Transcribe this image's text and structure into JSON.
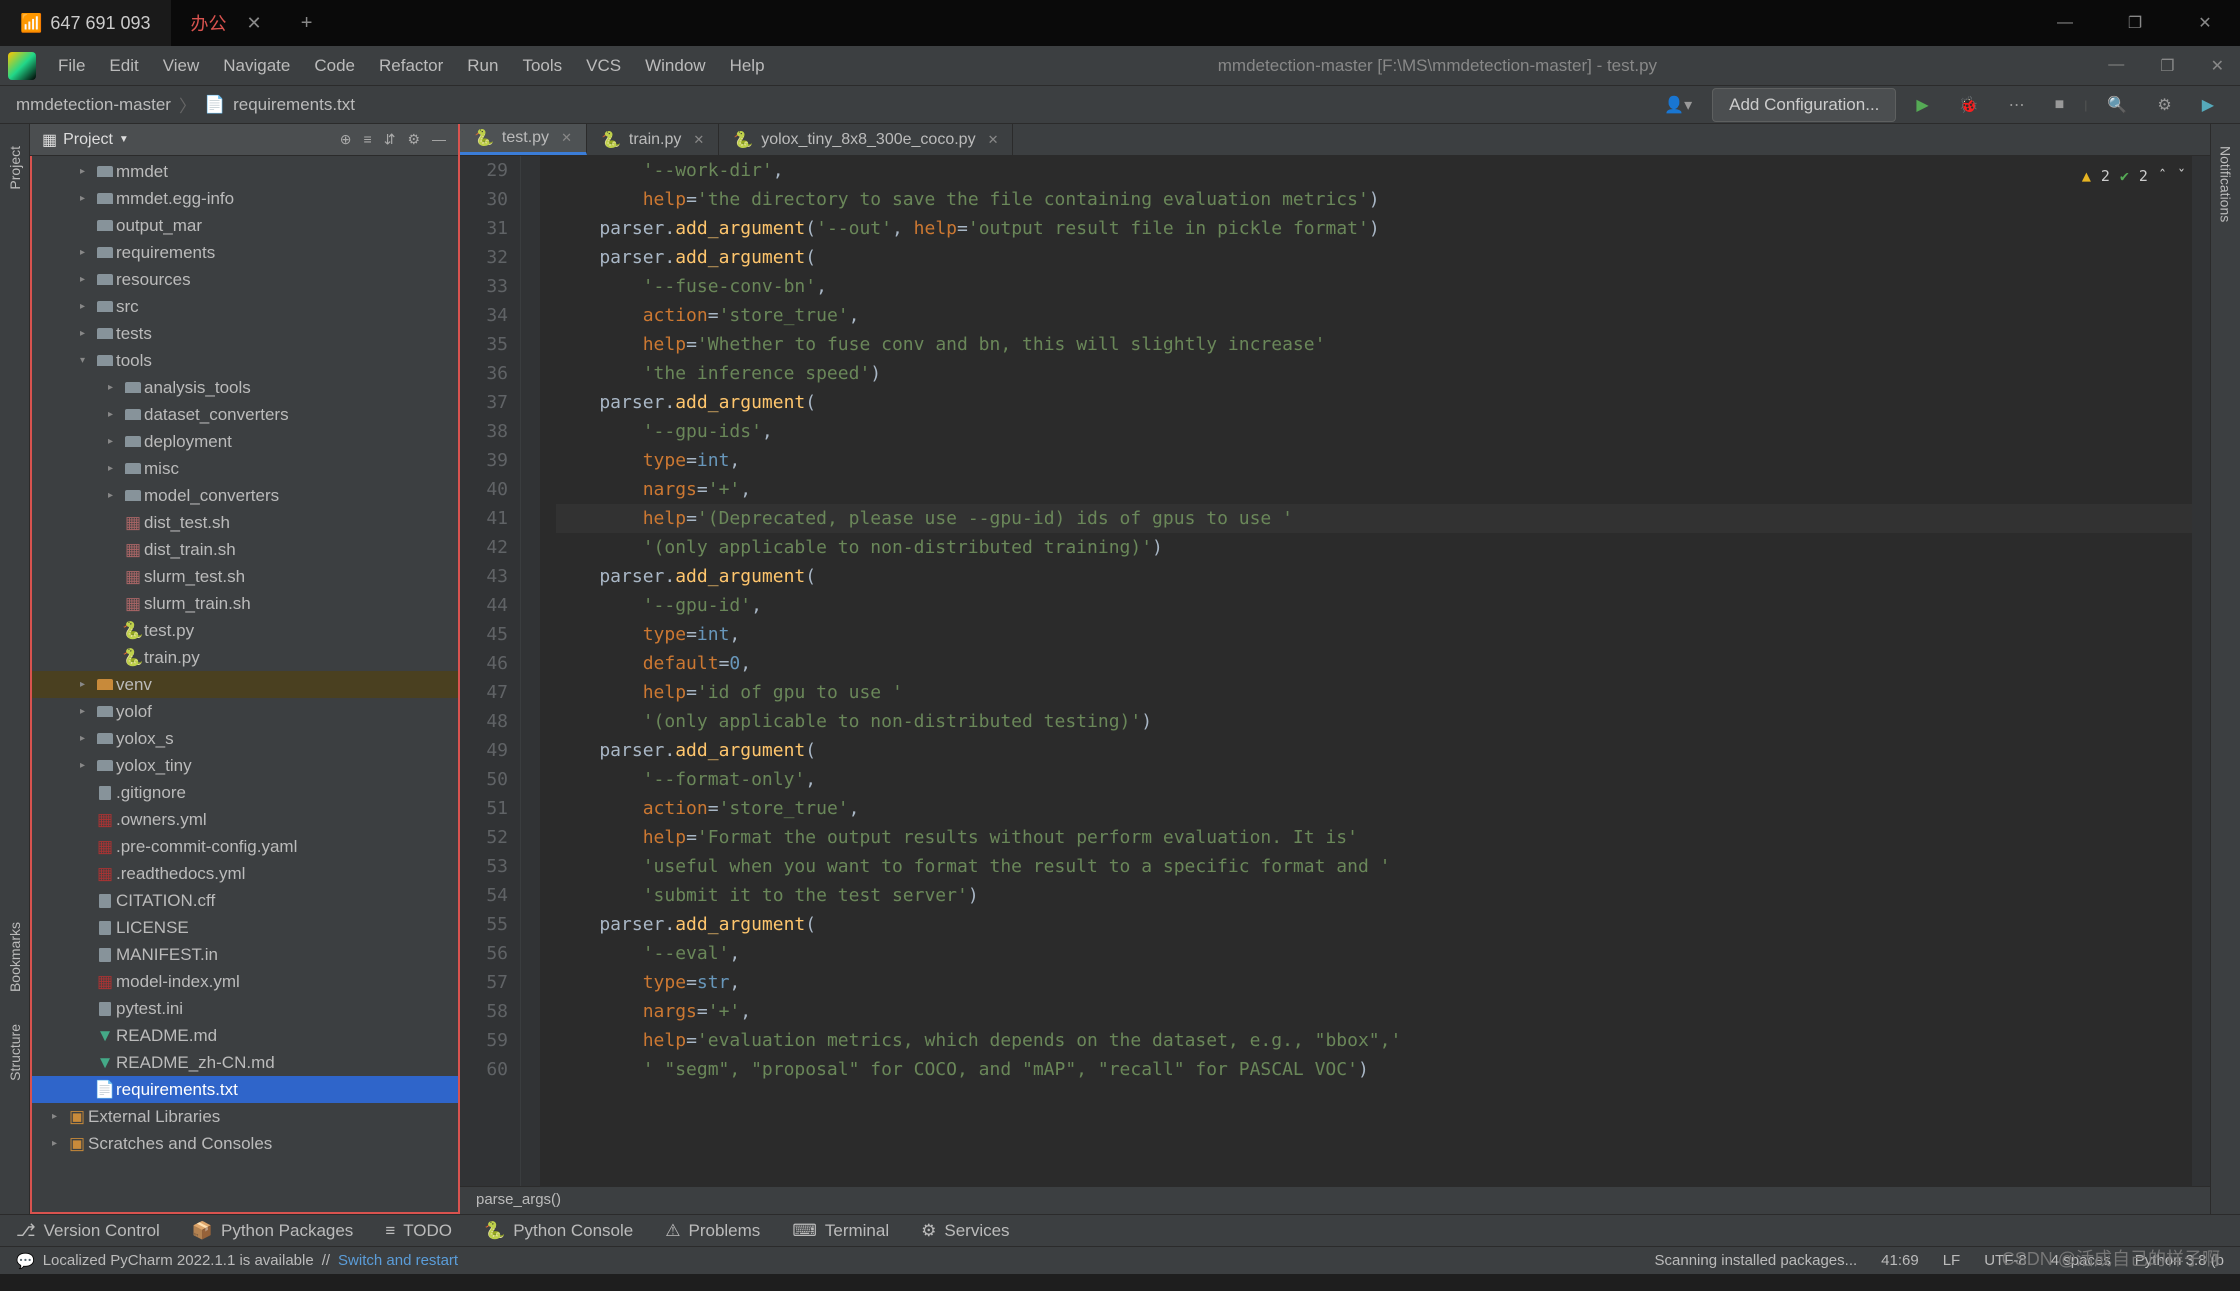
{
  "os_tab": {
    "status_icon": "📶",
    "title": "647 691 093",
    "second_label": "办公"
  },
  "ide_menu": [
    "File",
    "Edit",
    "View",
    "Navigate",
    "Code",
    "Refactor",
    "Run",
    "Tools",
    "VCS",
    "Window",
    "Help"
  ],
  "ide_title": "mmdetection-master [F:\\MS\\mmdetection-master] - test.py",
  "breadcrumb": [
    "mmdetection-master",
    "requirements.txt"
  ],
  "nav_right": {
    "add_config": "Add Configuration..."
  },
  "project_panel": {
    "title": "Project"
  },
  "tree": [
    {
      "d": 1,
      "t": "folder",
      "a": ">",
      "name": "mmdet"
    },
    {
      "d": 1,
      "t": "folder",
      "a": ">",
      "name": "mmdet.egg-info"
    },
    {
      "d": 1,
      "t": "folder",
      "a": "",
      "name": "output_mar"
    },
    {
      "d": 1,
      "t": "folder",
      "a": ">",
      "name": "requirements"
    },
    {
      "d": 1,
      "t": "folder",
      "a": ">",
      "name": "resources"
    },
    {
      "d": 1,
      "t": "folder",
      "a": ">",
      "name": "src"
    },
    {
      "d": 1,
      "t": "folder",
      "a": ">",
      "name": "tests"
    },
    {
      "d": 1,
      "t": "folder",
      "a": "v",
      "name": "tools"
    },
    {
      "d": 2,
      "t": "folder",
      "a": ">",
      "name": "analysis_tools"
    },
    {
      "d": 2,
      "t": "folder",
      "a": ">",
      "name": "dataset_converters"
    },
    {
      "d": 2,
      "t": "folder",
      "a": ">",
      "name": "deployment"
    },
    {
      "d": 2,
      "t": "folder",
      "a": ">",
      "name": "misc"
    },
    {
      "d": 2,
      "t": "folder",
      "a": ">",
      "name": "model_converters"
    },
    {
      "d": 2,
      "t": "sh",
      "a": "",
      "name": "dist_test.sh"
    },
    {
      "d": 2,
      "t": "sh",
      "a": "",
      "name": "dist_train.sh"
    },
    {
      "d": 2,
      "t": "sh",
      "a": "",
      "name": "slurm_test.sh"
    },
    {
      "d": 2,
      "t": "sh",
      "a": "",
      "name": "slurm_train.sh"
    },
    {
      "d": 2,
      "t": "py",
      "a": "",
      "name": "test.py"
    },
    {
      "d": 2,
      "t": "py",
      "a": "",
      "name": "train.py"
    },
    {
      "d": 1,
      "t": "folder-o",
      "a": ">",
      "name": "venv",
      "hl": true
    },
    {
      "d": 1,
      "t": "folder",
      "a": ">",
      "name": "yolof"
    },
    {
      "d": 1,
      "t": "folder",
      "a": ">",
      "name": "yolox_s"
    },
    {
      "d": 1,
      "t": "folder",
      "a": ">",
      "name": "yolox_tiny"
    },
    {
      "d": 1,
      "t": "file",
      "a": "",
      "name": ".gitignore"
    },
    {
      "d": 1,
      "t": "yml",
      "a": "",
      "name": ".owners.yml"
    },
    {
      "d": 1,
      "t": "yml",
      "a": "",
      "name": ".pre-commit-config.yaml"
    },
    {
      "d": 1,
      "t": "yml",
      "a": "",
      "name": ".readthedocs.yml"
    },
    {
      "d": 1,
      "t": "file",
      "a": "",
      "name": "CITATION.cff"
    },
    {
      "d": 1,
      "t": "file",
      "a": "",
      "name": "LICENSE"
    },
    {
      "d": 1,
      "t": "file",
      "a": "",
      "name": "MANIFEST.in"
    },
    {
      "d": 1,
      "t": "yml",
      "a": "",
      "name": "model-index.yml"
    },
    {
      "d": 1,
      "t": "file",
      "a": "",
      "name": "pytest.ini"
    },
    {
      "d": 1,
      "t": "md",
      "a": "",
      "name": "README.md"
    },
    {
      "d": 1,
      "t": "md",
      "a": "",
      "name": "README_zh-CN.md"
    },
    {
      "d": 1,
      "t": "txt",
      "a": "",
      "name": "requirements.txt",
      "sel": true
    }
  ],
  "tree_footer": [
    {
      "name": "External Libraries"
    },
    {
      "name": "Scratches and Consoles"
    }
  ],
  "editor_tabs": [
    {
      "name": "test.py",
      "active": true
    },
    {
      "name": "train.py"
    },
    {
      "name": "yolox_tiny_8x8_300e_coco.py"
    }
  ],
  "warnings": {
    "tri": "2",
    "check": "2"
  },
  "code_start_line": 29,
  "code_lines": [
    {
      "i": "        ",
      "t": [
        {
          "s": "'--work-dir'",
          "c": "str"
        },
        {
          "s": ","
        }
      ]
    },
    {
      "i": "        ",
      "t": [
        {
          "s": "help",
          "c": "kw"
        },
        {
          "s": "="
        },
        {
          "s": "'the directory to save the file containing evaluation metrics'",
          "c": "str"
        },
        {
          "s": ")"
        }
      ]
    },
    {
      "i": "    ",
      "t": [
        {
          "s": "parser."
        },
        {
          "s": "add_argument",
          "c": "fn"
        },
        {
          "s": "("
        },
        {
          "s": "'--out'",
          "c": "str"
        },
        {
          "s": ", "
        },
        {
          "s": "help",
          "c": "kw"
        },
        {
          "s": "="
        },
        {
          "s": "'output result file in pickle format'",
          "c": "str"
        },
        {
          "s": ")"
        }
      ]
    },
    {
      "i": "    ",
      "t": [
        {
          "s": "parser."
        },
        {
          "s": "add_argument",
          "c": "fn"
        },
        {
          "s": "("
        }
      ]
    },
    {
      "i": "        ",
      "t": [
        {
          "s": "'--fuse-conv-bn'",
          "c": "str"
        },
        {
          "s": ","
        }
      ]
    },
    {
      "i": "        ",
      "t": [
        {
          "s": "action",
          "c": "kw"
        },
        {
          "s": "="
        },
        {
          "s": "'store_true'",
          "c": "str"
        },
        {
          "s": ","
        }
      ]
    },
    {
      "i": "        ",
      "t": [
        {
          "s": "help",
          "c": "kw"
        },
        {
          "s": "="
        },
        {
          "s": "'Whether to fuse conv and bn, this will slightly increase'",
          "c": "str"
        }
      ]
    },
    {
      "i": "        ",
      "t": [
        {
          "s": "'the inference speed'",
          "c": "str"
        },
        {
          "s": ")"
        }
      ]
    },
    {
      "i": "    ",
      "t": [
        {
          "s": "parser."
        },
        {
          "s": "add_argument",
          "c": "fn"
        },
        {
          "s": "("
        }
      ]
    },
    {
      "i": "        ",
      "t": [
        {
          "s": "'--gpu-ids'",
          "c": "str"
        },
        {
          "s": ","
        }
      ]
    },
    {
      "i": "        ",
      "t": [
        {
          "s": "type",
          "c": "kw"
        },
        {
          "s": "="
        },
        {
          "s": "int",
          "c": "num"
        },
        {
          "s": ","
        }
      ]
    },
    {
      "i": "        ",
      "t": [
        {
          "s": "nargs",
          "c": "kw"
        },
        {
          "s": "="
        },
        {
          "s": "'+'",
          "c": "str"
        },
        {
          "s": ","
        }
      ]
    },
    {
      "i": "        ",
      "t": [
        {
          "s": "help",
          "c": "kw"
        },
        {
          "s": "="
        },
        {
          "s": "'(Deprecated, please use --gpu-id) ids of gpus to use '",
          "c": "str"
        }
      ],
      "hl": true
    },
    {
      "i": "        ",
      "t": [
        {
          "s": "'(only applicable to non-distributed training)'",
          "c": "str"
        },
        {
          "s": ")"
        }
      ]
    },
    {
      "i": "    ",
      "t": [
        {
          "s": "parser."
        },
        {
          "s": "add_argument",
          "c": "fn"
        },
        {
          "s": "("
        }
      ]
    },
    {
      "i": "        ",
      "t": [
        {
          "s": "'--gpu-id'",
          "c": "str"
        },
        {
          "s": ","
        }
      ]
    },
    {
      "i": "        ",
      "t": [
        {
          "s": "type",
          "c": "kw"
        },
        {
          "s": "="
        },
        {
          "s": "int",
          "c": "num"
        },
        {
          "s": ","
        }
      ]
    },
    {
      "i": "        ",
      "t": [
        {
          "s": "default",
          "c": "kw"
        },
        {
          "s": "="
        },
        {
          "s": "0",
          "c": "num"
        },
        {
          "s": ","
        }
      ]
    },
    {
      "i": "        ",
      "t": [
        {
          "s": "help",
          "c": "kw"
        },
        {
          "s": "="
        },
        {
          "s": "'id of gpu to use '",
          "c": "str"
        }
      ]
    },
    {
      "i": "        ",
      "t": [
        {
          "s": "'(only applicable to non-distributed testing)'",
          "c": "str"
        },
        {
          "s": ")"
        }
      ]
    },
    {
      "i": "    ",
      "t": [
        {
          "s": "parser."
        },
        {
          "s": "add_argument",
          "c": "fn"
        },
        {
          "s": "("
        }
      ]
    },
    {
      "i": "        ",
      "t": [
        {
          "s": "'--format-only'",
          "c": "str"
        },
        {
          "s": ","
        }
      ]
    },
    {
      "i": "        ",
      "t": [
        {
          "s": "action",
          "c": "kw"
        },
        {
          "s": "="
        },
        {
          "s": "'store_true'",
          "c": "str"
        },
        {
          "s": ","
        }
      ]
    },
    {
      "i": "        ",
      "t": [
        {
          "s": "help",
          "c": "kw"
        },
        {
          "s": "="
        },
        {
          "s": "'Format the output results without perform evaluation. It is'",
          "c": "str"
        }
      ]
    },
    {
      "i": "        ",
      "t": [
        {
          "s": "'useful when you want to format the result to a specific format and '",
          "c": "str"
        }
      ]
    },
    {
      "i": "        ",
      "t": [
        {
          "s": "'submit it to the test server'",
          "c": "str"
        },
        {
          "s": ")"
        }
      ]
    },
    {
      "i": "    ",
      "t": [
        {
          "s": "parser."
        },
        {
          "s": "add_argument",
          "c": "fn"
        },
        {
          "s": "("
        }
      ]
    },
    {
      "i": "        ",
      "t": [
        {
          "s": "'--eval'",
          "c": "str"
        },
        {
          "s": ","
        }
      ]
    },
    {
      "i": "        ",
      "t": [
        {
          "s": "type",
          "c": "kw"
        },
        {
          "s": "="
        },
        {
          "s": "str",
          "c": "num"
        },
        {
          "s": ","
        }
      ]
    },
    {
      "i": "        ",
      "t": [
        {
          "s": "nargs",
          "c": "kw"
        },
        {
          "s": "="
        },
        {
          "s": "'+'",
          "c": "str"
        },
        {
          "s": ","
        }
      ]
    },
    {
      "i": "        ",
      "t": [
        {
          "s": "help",
          "c": "kw"
        },
        {
          "s": "="
        },
        {
          "s": "'evaluation metrics, which depends on the dataset, e.g., \"bbox\",'",
          "c": "str"
        }
      ]
    },
    {
      "i": "        ",
      "t": [
        {
          "s": "' \"segm\", \"proposal\" for COCO, and \"mAP\", \"recall\" for PASCAL VOC'",
          "c": "str"
        },
        {
          "s": ")"
        }
      ]
    }
  ],
  "code_breadcrumb": "parse_args()",
  "tool_bar": [
    "Version Control",
    "Python Packages",
    "TODO",
    "Python Console",
    "Problems",
    "Terminal",
    "Services"
  ],
  "status": {
    "left": "Localized PyCharm 2022.1.1 is available",
    "link": "Switch and restart",
    "scanning": "Scanning installed packages...",
    "pos": "41:69",
    "lf": "LF",
    "enc": "UTF-8",
    "indent": "4 spaces",
    "py": "Python 3.8 (b"
  },
  "watermark": "CSDN @活成自己的样子啊"
}
